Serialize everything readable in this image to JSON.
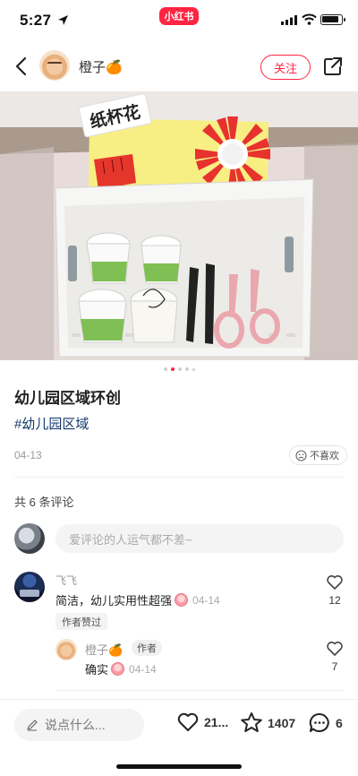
{
  "status_bar": {
    "time": "5:27",
    "app_badge": "小红书"
  },
  "header": {
    "author_name": "橙子🍊",
    "follow_label": "关注"
  },
  "post": {
    "image_text": "纸杯花",
    "title": "幼儿园区域环创",
    "tag": "#幼儿园区域",
    "date": "04-13",
    "dislike_label": "不喜欢",
    "carousel_total": 5,
    "carousel_active": 2
  },
  "comments": {
    "count_label": "共 6 条评论",
    "input_placeholder": "爱评论的人运气都不差~",
    "items": [
      {
        "user": "飞飞",
        "text": "简洁，幼儿实用性超强",
        "date": "04-14",
        "badge": "作者赞过",
        "likes": "12"
      }
    ],
    "replies": [
      {
        "user": "橙子🍊",
        "author_badge": "作者",
        "text": "确实",
        "date": "04-14",
        "likes": "7"
      }
    ]
  },
  "bottom_bar": {
    "say_placeholder": "说点什么...",
    "like_count": "21...",
    "collect_count": "1407",
    "comment_count": "6"
  },
  "colors": {
    "brand": "#ff2442",
    "tag": "#13386c"
  }
}
